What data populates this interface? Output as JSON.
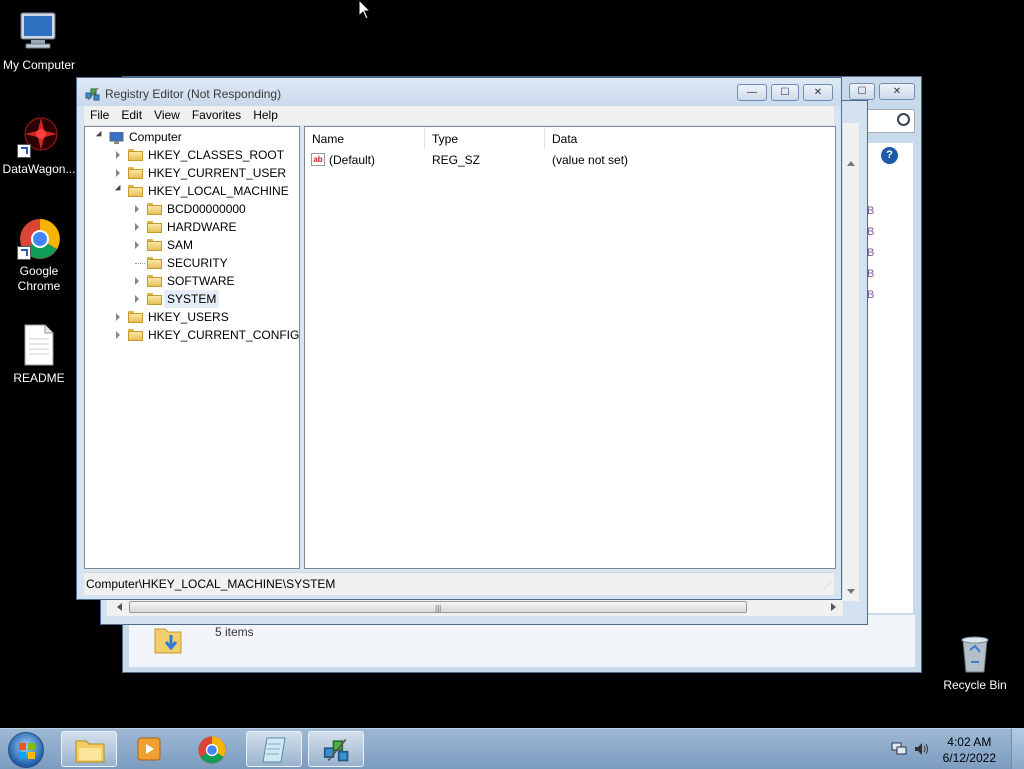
{
  "desktop": {
    "icons": [
      {
        "label": "My Computer",
        "icon": "my-computer-icon"
      },
      {
        "label": "DataWagon...",
        "icon": "datawagon-icon"
      },
      {
        "label": "Google Chrome",
        "icon": "chrome-icon"
      },
      {
        "label": "README",
        "icon": "document-icon"
      },
      {
        "label": "Recycle Bin",
        "icon": "recycle-bin-icon"
      }
    ]
  },
  "background_window": {
    "status": "5 items",
    "size_suffix": "B"
  },
  "regedit": {
    "title": "Registry Editor (Not Responding)",
    "controls": {
      "minimize": "—",
      "maximize": "☐",
      "close": "✕"
    },
    "menu": [
      "File",
      "Edit",
      "View",
      "Favorites",
      "Help"
    ],
    "tree": {
      "root": "Computer",
      "items": [
        {
          "label": "HKEY_CLASSES_ROOT",
          "expanded": false
        },
        {
          "label": "HKEY_CURRENT_USER",
          "expanded": false
        },
        {
          "label": "HKEY_LOCAL_MACHINE",
          "expanded": true
        },
        {
          "label": "BCD00000000",
          "expanded": false
        },
        {
          "label": "HARDWARE",
          "expanded": false
        },
        {
          "label": "SAM",
          "expanded": false
        },
        {
          "label": "SECURITY",
          "expanded": false
        },
        {
          "label": "SOFTWARE",
          "expanded": false
        },
        {
          "label": "SYSTEM",
          "expanded": false,
          "selected": true
        },
        {
          "label": "HKEY_USERS",
          "expanded": false
        },
        {
          "label": "HKEY_CURRENT_CONFIG",
          "expanded": false
        }
      ]
    },
    "columns": [
      "Name",
      "Type",
      "Data"
    ],
    "rows": [
      {
        "name": "(Default)",
        "type": "REG_SZ",
        "data": "(value not set)",
        "icon": "ab-string-icon"
      }
    ],
    "status_path": "Computer\\HKEY_LOCAL_MACHINE\\SYSTEM"
  },
  "taskbar": {
    "time": "4:02 AM",
    "date": "6/12/2022"
  },
  "colors": {
    "taskbar": "#8eaacb",
    "window_frame": "#c9d9ec",
    "selection": "#e5eef7"
  }
}
